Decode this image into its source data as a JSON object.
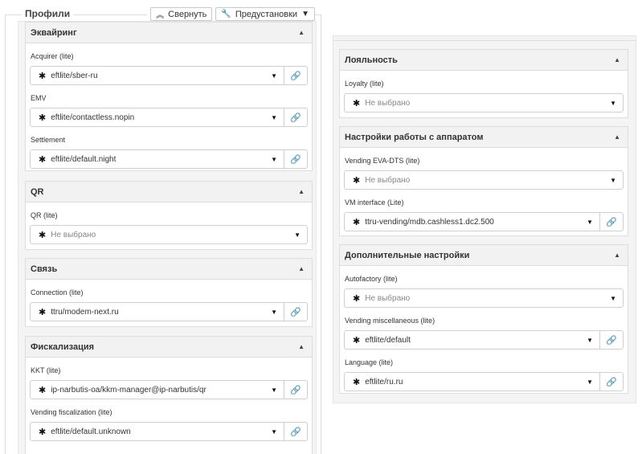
{
  "profiles": {
    "legend": "Профили",
    "collapse_label": "Свернуть",
    "presets_label": "Предустановки"
  },
  "left": {
    "acquiring": {
      "title": "Эквайринг",
      "fields": [
        {
          "label": "Acquirer (lite)",
          "value": "eftlite/sber-ru"
        },
        {
          "label": "EMV",
          "value": "eftlite/contactless.nopin"
        },
        {
          "label": "Settlement",
          "value": "eftlite/default.night"
        }
      ]
    },
    "qr": {
      "title": "QR",
      "fields": [
        {
          "label": "QR (lite)",
          "value": "Не выбрано"
        }
      ]
    },
    "connection": {
      "title": "Связь",
      "fields": [
        {
          "label": "Connection (lite)",
          "value": "ttru/modem-next.ru"
        }
      ]
    },
    "fiscal": {
      "title": "Фискализация",
      "fields": [
        {
          "label": "KKT (lite)",
          "value": "ip-narbutis-oa/kkm-manager@ip-narbutis/qr"
        },
        {
          "label": "Vending fiscalization (lite)",
          "value": "eftlite/default.unknown"
        }
      ]
    }
  },
  "right": {
    "loyalty": {
      "title": "Лояльность",
      "fields": [
        {
          "label": "Loyalty (lite)",
          "value": "Не выбрано"
        }
      ]
    },
    "device": {
      "title": "Настройки работы с аппаратом",
      "fields": [
        {
          "label": "Vending EVA-DTS (lite)",
          "value": "Не выбрано"
        },
        {
          "label": "VM interface (Lite)",
          "value": "ttru-vending/mdb.cashless1.dc2.500"
        }
      ]
    },
    "extra": {
      "title": "Дополнительные настройки",
      "fields": [
        {
          "label": "Autofactory (lite)",
          "value": "Не выбрано"
        },
        {
          "label": "Vending miscellaneous (lite)",
          "value": "eftlite/default"
        },
        {
          "label": "Language (lite)",
          "value": "eftlite/ru.ru"
        }
      ]
    }
  },
  "icons": {
    "profile": "puzzle-icon",
    "dropdown": "chevron-down-icon",
    "link": "link-icon",
    "collapse": "panel-collapse-icon"
  }
}
